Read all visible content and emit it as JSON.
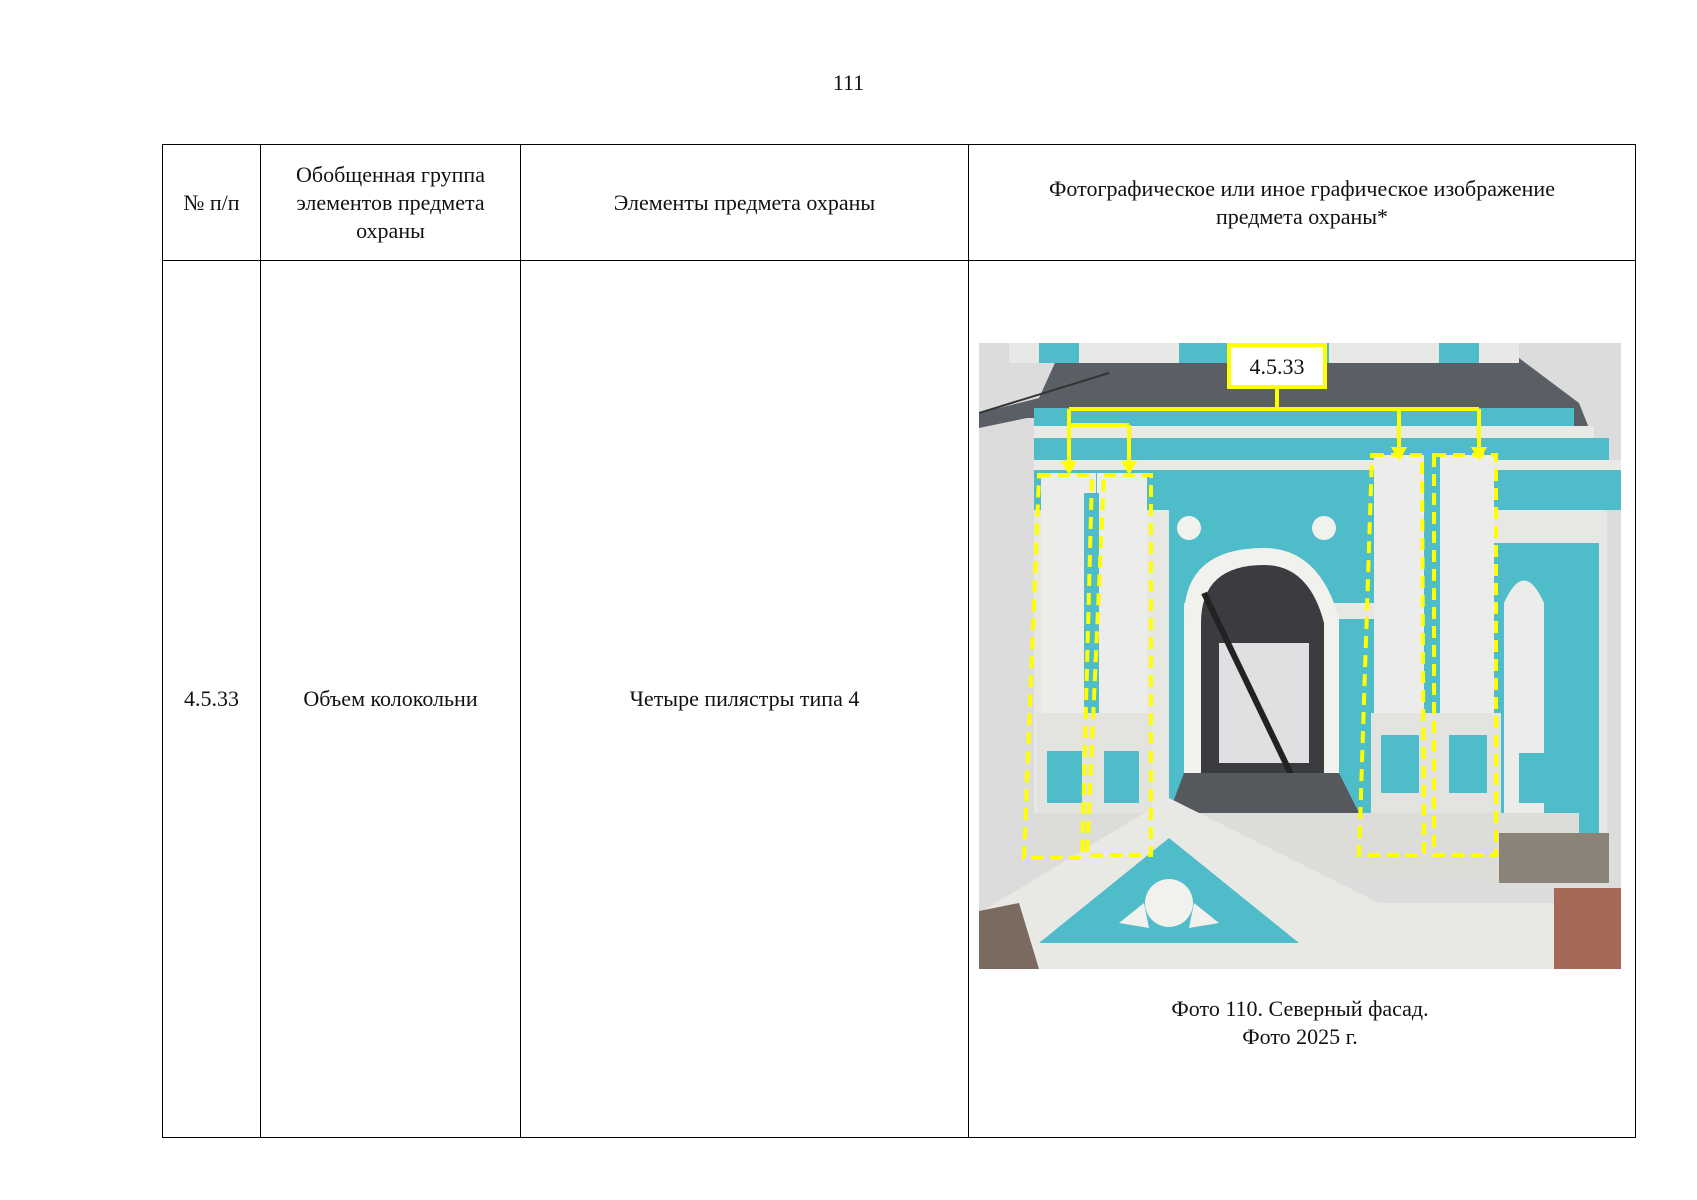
{
  "page_number": "111",
  "table": {
    "headers": {
      "num": "№ п/п",
      "group": "Обобщенная группа элементов предмета охраны",
      "elements": "Элементы предмета охраны",
      "image": "Фотографическое или иное графическое изображение предмета охраны*"
    },
    "row": {
      "num": "4.5.33",
      "group": "Объем колокольни",
      "elements": "Четыре пилястры типа 4",
      "photo_label": "4.5.33",
      "caption_line1": "Фото 110. Северный фасад.",
      "caption_line2": "Фото 2025 г."
    }
  },
  "colors": {
    "facade_blue": "#4fbcc9",
    "facade_white": "#e6e6e3",
    "highlight": "#ffff00",
    "roof": "#555a60",
    "sky": "#dcdcdc"
  }
}
